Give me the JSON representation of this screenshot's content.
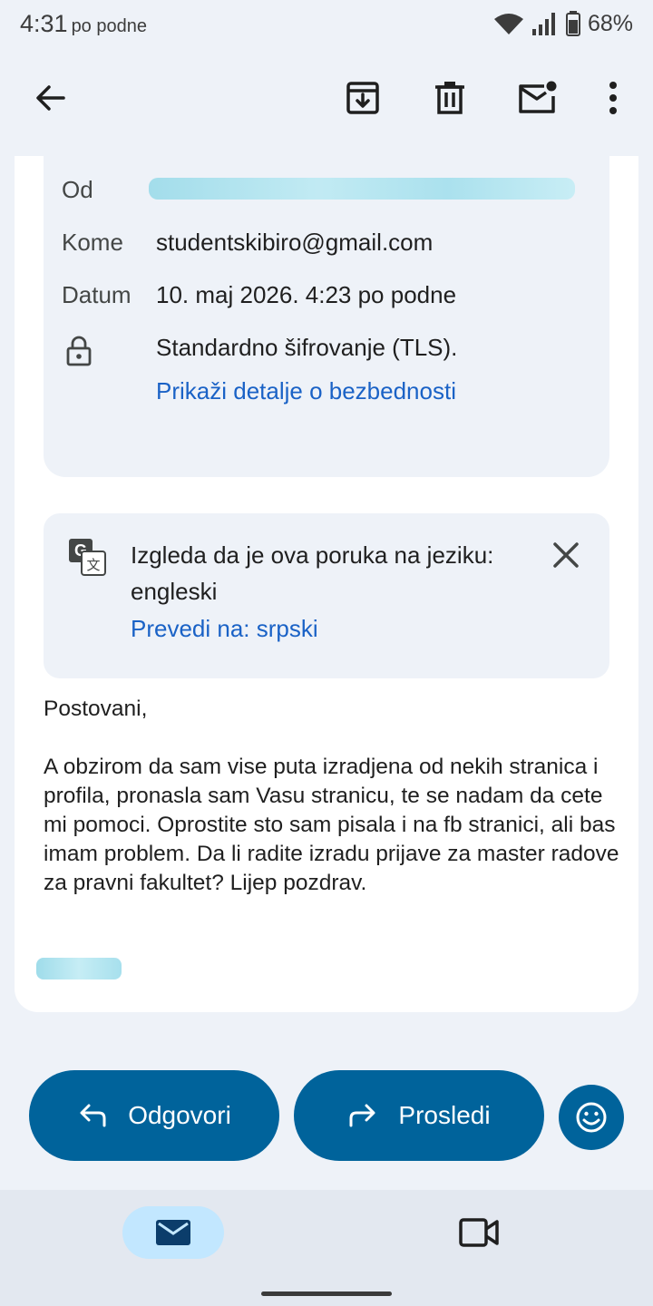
{
  "status_bar": {
    "time": "4:31",
    "time_suffix": "po podne",
    "battery": "68%"
  },
  "toolbar": {
    "back_icon": "arrow-left-icon",
    "archive_icon": "archive-icon",
    "delete_icon": "trash-icon",
    "mark_unread_icon": "mail-unread-icon",
    "more_icon": "more-vert-icon"
  },
  "details": {
    "from_label": "Od",
    "to_label": "Kome",
    "to_value": "studentskibiro@gmail.com",
    "date_label": "Datum",
    "date_value": "10. maj 2026. 4:23 po podne",
    "encryption_text": "Standardno šifrovanje (TLS).",
    "security_link": "Prikaži detalje o bezbednosti"
  },
  "translate": {
    "message": "Izgleda da je ova poruka na jeziku: engleski",
    "action": "Prevedi na: srpski"
  },
  "email": {
    "greeting": "Postovani,",
    "body": "A obzirom da sam vise puta izradjena od nekih stranica i profila, pronasla sam Vasu stranicu, te se nadam da cete mi pomoci. Oprostite sto sam pisala i na fb stranici, ali bas imam problem. Da li radite izradu prijave za master radove za pravni fakultet? Lijep pozdrav."
  },
  "actions": {
    "reply_label": "Odgovori",
    "forward_label": "Prosledi"
  },
  "colors": {
    "primary": "#00639b",
    "link": "#1a62c6",
    "nav_active": "#c2e7ff"
  }
}
